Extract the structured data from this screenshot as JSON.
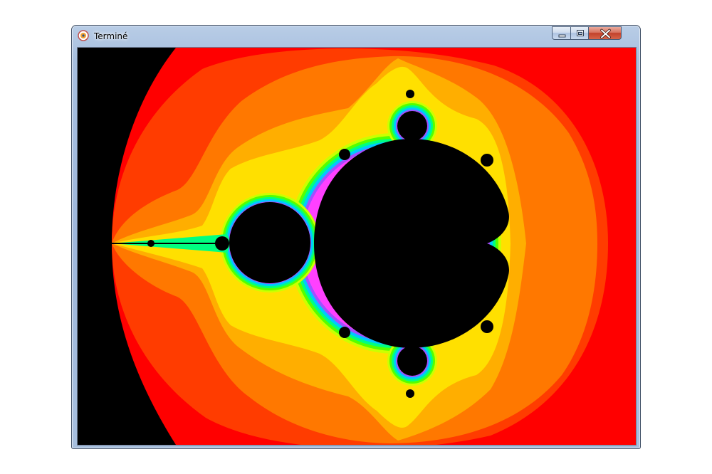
{
  "window": {
    "title": "Terminé",
    "app_icon": "app-icon",
    "controls": {
      "minimize_icon": "minimize-icon",
      "maximize_icon": "maximize-icon",
      "close_icon": "close-icon"
    }
  },
  "fractal": {
    "set": "mandelbrot",
    "palette": [
      "#ff0000",
      "#ff3c00",
      "#ff7800",
      "#ffae00",
      "#ffe000",
      "#ccff00",
      "#55ff00",
      "#00ff80",
      "#00c8ff",
      "#a050ff",
      "#ff40ff"
    ],
    "set_color": "#000000"
  }
}
